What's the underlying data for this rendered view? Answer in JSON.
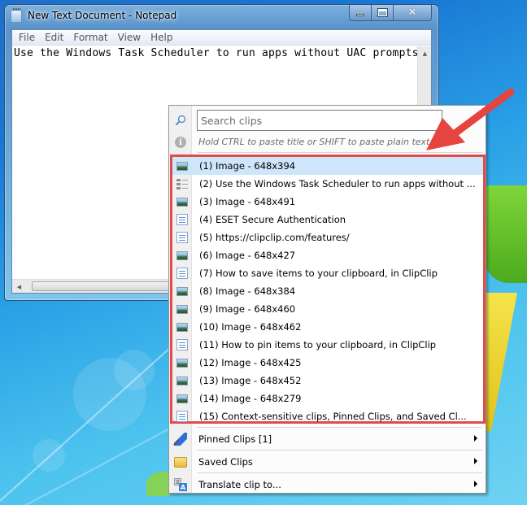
{
  "notepad": {
    "title": "New Text Document - Notepad",
    "menu": [
      "File",
      "Edit",
      "Format",
      "View",
      "Help"
    ],
    "content": "Use the Windows Task Scheduler to run apps without UAC prompts",
    "controls": {
      "minimize": "minimize",
      "maximize": "maximize",
      "close": "close"
    }
  },
  "clipclip": {
    "search": {
      "placeholder": "Search clips",
      "value": ""
    },
    "hint": "Hold CTRL to paste title or SHIFT to paste plain text",
    "clips": [
      {
        "label": "(1) Image - 648x394",
        "type": "image",
        "selected": true
      },
      {
        "label": "(2) Use the Windows Task Scheduler to run apps without ...",
        "type": "list",
        "selected": false
      },
      {
        "label": "(3) Image - 648x491",
        "type": "image",
        "selected": false
      },
      {
        "label": "(4) ESET Secure Authentication",
        "type": "text",
        "selected": false
      },
      {
        "label": "(5) https://clipclip.com/features/",
        "type": "text",
        "selected": false
      },
      {
        "label": "(6) Image - 648x427",
        "type": "image",
        "selected": false
      },
      {
        "label": "(7) How to save items to your clipboard, in ClipClip",
        "type": "text",
        "selected": false
      },
      {
        "label": "(8) Image - 648x384",
        "type": "image",
        "selected": false
      },
      {
        "label": "(9) Image - 648x460",
        "type": "image",
        "selected": false
      },
      {
        "label": "(10) Image - 648x462",
        "type": "image",
        "selected": false
      },
      {
        "label": "(11) How to pin items to your clipboard, in ClipClip",
        "type": "text",
        "selected": false
      },
      {
        "label": "(12) Image - 648x425",
        "type": "image",
        "selected": false
      },
      {
        "label": "(13) Image - 648x452",
        "type": "image",
        "selected": false
      },
      {
        "label": "(14) Image - 648x279",
        "type": "image",
        "selected": false
      },
      {
        "label": "(15) Context-sensitive clips, Pinned Clips, and Saved Cl...",
        "type": "text",
        "selected": false
      }
    ],
    "submenus": [
      {
        "label": "Pinned Clips [1]",
        "icon": "pin-icon"
      },
      {
        "label": "Saved Clips",
        "icon": "folder-icon"
      },
      {
        "label": "Translate clip to...",
        "icon": "translate-icon"
      }
    ],
    "highlight_color": "#e34a4a",
    "selection_color": "#cde6fb"
  }
}
